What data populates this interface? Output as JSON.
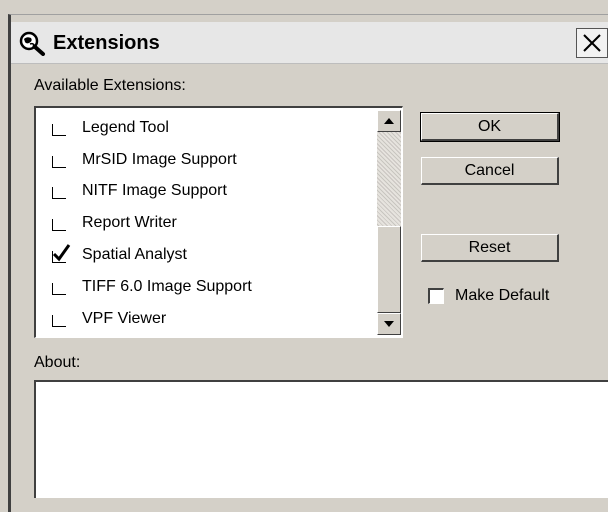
{
  "window": {
    "title": "Extensions",
    "title_icon": "magnifier-globe-icon",
    "close_icon": "close-icon"
  },
  "extensions_list": {
    "label": "Available Extensions:",
    "items": [
      {
        "label": "Legend Tool",
        "checked": false
      },
      {
        "label": "MrSID Image Support",
        "checked": false
      },
      {
        "label": "NITF Image Support",
        "checked": false
      },
      {
        "label": "Report Writer",
        "checked": false
      },
      {
        "label": "Spatial Analyst",
        "checked": true
      },
      {
        "label": "TIFF 6.0 Image Support",
        "checked": false
      },
      {
        "label": "VPF Viewer",
        "checked": false
      }
    ]
  },
  "buttons": {
    "ok": "OK",
    "cancel": "Cancel",
    "reset": "Reset"
  },
  "make_default": {
    "label": "Make Default",
    "checked": false
  },
  "about": {
    "label": "About:",
    "text": ""
  }
}
